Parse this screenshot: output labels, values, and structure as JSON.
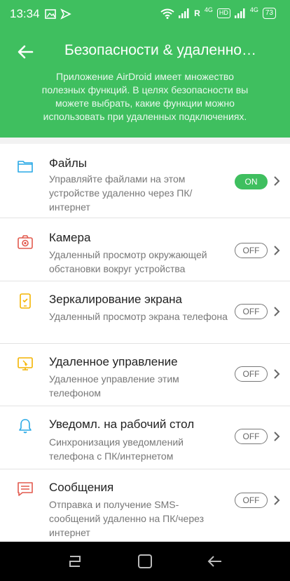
{
  "status_bar": {
    "time": "13:34",
    "network_r": "R",
    "network_4g_1": "4G",
    "hd": "HD",
    "network_4g_2": "4G",
    "battery": "73"
  },
  "header": {
    "title": "Безопасности & удаленно…",
    "subtitle": "Приложение AirDroid имеет множество полезных функций. В целях безопасности вы можете выбрать, какие функции можно использовать при удаленных подключениях."
  },
  "features": [
    {
      "title": "Файлы",
      "desc": "Управляйте файлами на этом устройстве удаленно через ПК/интернет",
      "toggle": "ON",
      "icon": "folder-icon",
      "color": "#29a9e6"
    },
    {
      "title": "Камера",
      "desc": "Удаленный просмотр окружающей обстановки вокруг устройства",
      "toggle": "OFF",
      "icon": "camera-icon",
      "color": "#e25a4e"
    },
    {
      "title": "Зеркалирование экрана",
      "desc": "Удаленный просмотр экрана телефона",
      "toggle": "OFF",
      "icon": "phone-mirror-icon",
      "color": "#f4b400"
    },
    {
      "title": "Удаленное управление",
      "desc": "Удаленное управление этим телефоном",
      "toggle": "OFF",
      "icon": "remote-control-icon",
      "color": "#f4b400"
    },
    {
      "title": "Уведомл. на рабочий стол",
      "desc": "Синхронизация уведомлений телефона с ПК/интернетом",
      "toggle": "OFF",
      "icon": "bell-icon",
      "color": "#29a9e6"
    },
    {
      "title": "Сообщения",
      "desc": "Отправка и получение SMS-сообщений удаленно на ПК/через интернет",
      "toggle": "OFF",
      "icon": "message-icon",
      "color": "#e25a4e"
    }
  ],
  "colors": {
    "header": "#3fbf5f",
    "toggle_on": "#3fbf5f"
  }
}
